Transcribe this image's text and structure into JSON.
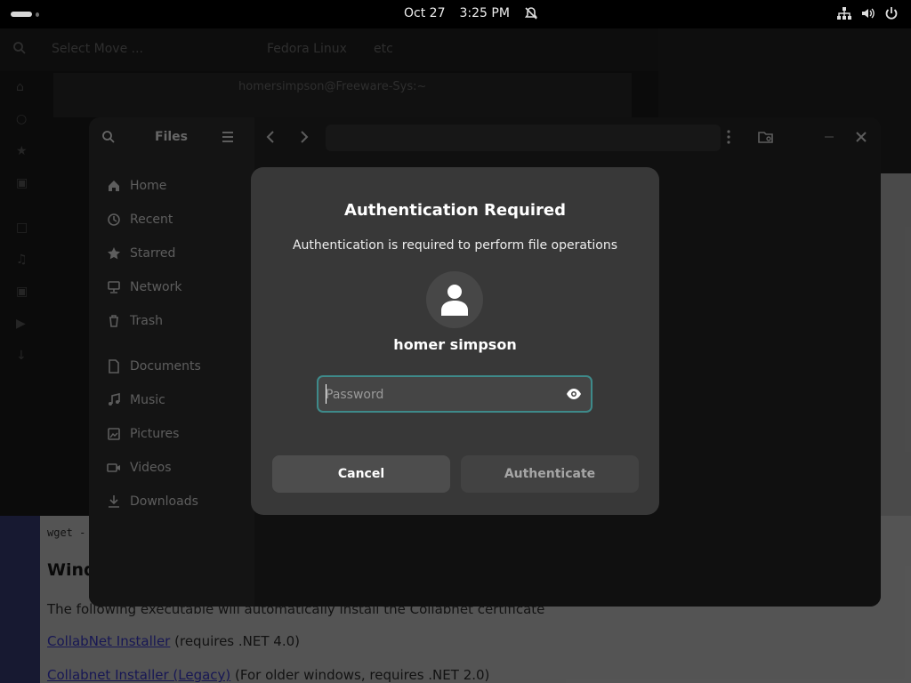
{
  "topbar": {
    "date": "Oct 27",
    "time": "3:25 PM"
  },
  "background": {
    "app_search": "Select Move ...",
    "app_tab": "Fedora Linux",
    "app_path": "etc",
    "terminal_title": "homersimpson@Freeware-Sys:~",
    "webpage": {
      "wget": "wget -",
      "heading": "Wind",
      "line1": "The following executable will automatically install the Collabnet certificate",
      "link1": "CollabNet Installer",
      "line2_rest": " (requires .NET 4.0)",
      "link2": "Collabnet Installer (Legacy)",
      "line3_rest": " (For older windows, requires .NET 2.0)"
    }
  },
  "files": {
    "title": "Files",
    "sidebar": {
      "places": [
        {
          "label": "Home",
          "icon": "home-icon"
        },
        {
          "label": "Recent",
          "icon": "clock-icon"
        },
        {
          "label": "Starred",
          "icon": "star-icon"
        },
        {
          "label": "Network",
          "icon": "network-icon"
        },
        {
          "label": "Trash",
          "icon": "trash-icon"
        }
      ],
      "bookmarks": [
        {
          "label": "Documents",
          "icon": "document-icon"
        },
        {
          "label": "Music",
          "icon": "music-icon"
        },
        {
          "label": "Pictures",
          "icon": "picture-icon"
        },
        {
          "label": "Videos",
          "icon": "video-icon"
        },
        {
          "label": "Downloads",
          "icon": "download-icon"
        }
      ]
    }
  },
  "dialog": {
    "title": "Authentication Required",
    "subtitle": "Authentication is required to perform file operations",
    "username": "homer simpson",
    "password_placeholder": "Password",
    "cancel_label": "Cancel",
    "authenticate_label": "Authenticate",
    "focus_color": "#3e8a8a"
  }
}
